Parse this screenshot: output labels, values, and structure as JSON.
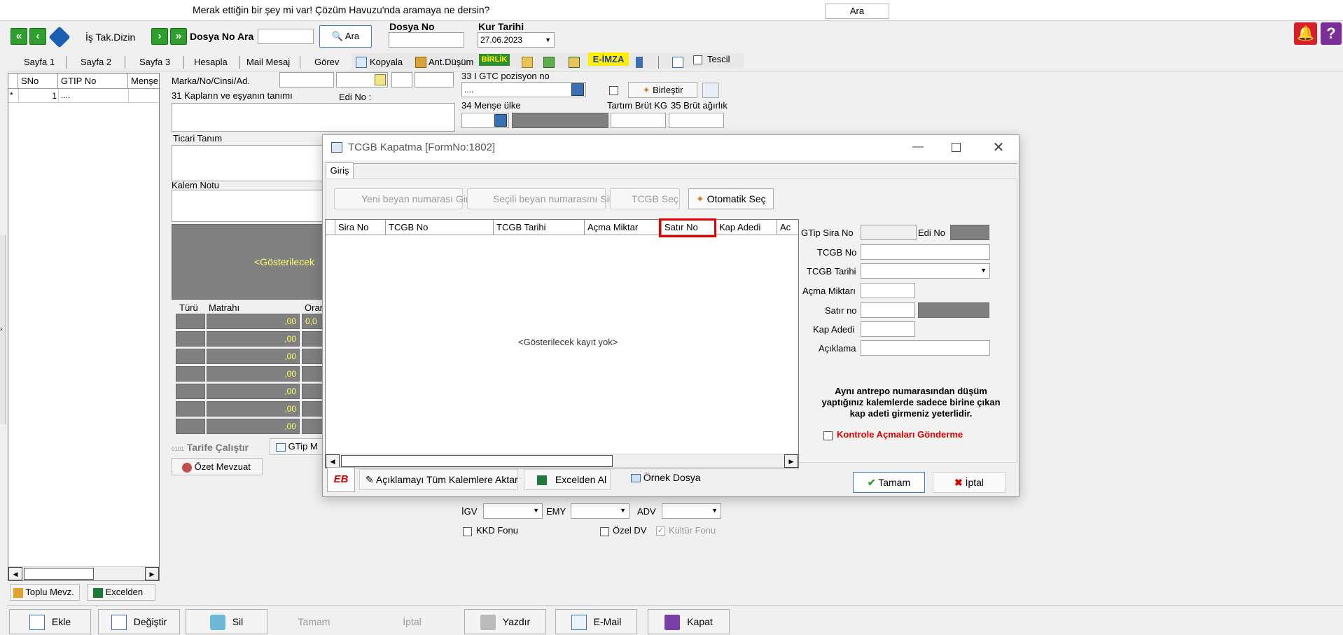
{
  "search_bar": {
    "text": "Merak ettiğin bir şey mi var! Çözüm Havuzu'nda aramaya ne dersin?",
    "button": "Ara"
  },
  "toolbar": {
    "is_tak_dizin": "İş Tak.Dizin",
    "dosya_no_ara": "Dosya No Ara",
    "ara_button": "Ara",
    "dosya_no_label": "Dosya No",
    "kur_tarihi_label": "Kur Tarihi",
    "kur_tarihi_value": "27.06.2023"
  },
  "tabs": [
    "Sayfa 1",
    "Sayfa 2",
    "Sayfa 3",
    "Hesapla",
    "Mail Mesaj",
    "Görev"
  ],
  "tools": {
    "kopyala": "Kopyala",
    "ant_dusum": "Ant.Düşüm",
    "birlik": "BİRLİK",
    "e_imza": "E-İMZA",
    "tescil": "Tescil"
  },
  "left_grid": {
    "headers": [
      "SNo",
      "GTIP No",
      "Menşe"
    ],
    "row": {
      "marker": "*",
      "sno": "1",
      "gtip": "...."
    }
  },
  "left_buttons": {
    "toplu": "Toplu Mevz.",
    "excelden": "Excelden"
  },
  "form": {
    "marka": "Marka/No/Cinsi/Ad.",
    "kaplar": "31 Kapların ve eşyanın tanımı",
    "edi_no": "Edi No :",
    "ticari": "Ticari Tanım",
    "kalem_notu": "Kalem Notu",
    "gosterilecek": "<Gösterilecek",
    "tax_headers": [
      "Türü",
      "Matrahı",
      "Oran"
    ],
    "tax_values": [
      ",00",
      ",00",
      ",00",
      ",00",
      ",00",
      ",00",
      ",00"
    ],
    "tax_orans": [
      "0,0"
    ],
    "tarife": "Tarife Çalıştır",
    "gtip_m": "GTip M",
    "ozet": "Özet Mevzuat",
    "gtc": "33 I GTC pozisyon no",
    "gtc_value": "....",
    "birlestir": "Birleştir",
    "mense_ulke": "34 Menşe ülke",
    "tartim_brut": "Tartım Brüt KG",
    "brut_agirlik": "35 Brüt ağırlık",
    "igv": "İGV",
    "emy": "EMY",
    "adv": "ADV",
    "kkd": "KKD Fonu",
    "ozel_dv": "Özel DV",
    "kultur": "Kültür Fonu"
  },
  "dialog": {
    "title": "TCGB Kapatma [FormNo:1802]",
    "tab": "Giriş",
    "btn_yeni": "Yeni beyan numarası Gir",
    "btn_secili": "Seçili beyan numarasını Sil",
    "btn_tcgb_sec": "TCGB Seç",
    "btn_otomatik": "Otomatik Seç",
    "grid_headers": [
      "Sira No",
      "TCGB No",
      "TCGB Tarihi",
      "Açma Miktar",
      "Satır No",
      "Kap Adedi",
      "Ac"
    ],
    "empty": "<Gösterilecek kayıt yok>",
    "gtip_sira": "GTip Sira No",
    "edi_no": "Edi No",
    "tcgb_no": "TCGB No",
    "tcgb_tarihi": "TCGB Tarihi",
    "acma_miktari": "Açma Miktarı",
    "satir_no": "Satır no",
    "kap_adedi": "Kap Adedi",
    "aciklama": "Açıklama",
    "info": "Aynı antrepo numarasından düşüm yaptığınız kalemlerde sadece birine çıkan kap adeti girmeniz yeterlidir.",
    "kontrole": "Kontrole Açmaları Gönderme",
    "btn_aciklamayi": "Açıklamayı Tüm Kalemlere Aktar",
    "btn_excelden": "Excelden Al",
    "btn_ornek": "Örnek Dosya",
    "btn_tamam": "Tamam",
    "btn_iptal": "İptal"
  },
  "bottom": {
    "ekle": "Ekle",
    "degistir": "Değiştir",
    "sil": "Sil",
    "tamam": "Tamam",
    "iptal": "İptal",
    "yazdir": "Yazdır",
    "email": "E-Mail",
    "kapat": "Kapat"
  },
  "colors": {
    "green": "#2e9e2e",
    "highlight": "#e00000",
    "yellow_text": "#ffff66",
    "dark_panel": "#808080"
  }
}
